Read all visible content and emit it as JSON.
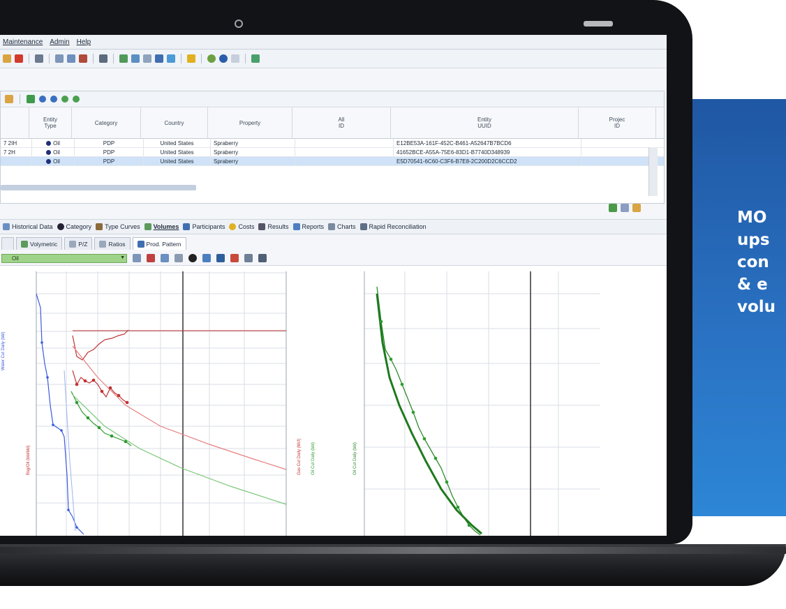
{
  "menu": {
    "items": [
      "Maintenance",
      "Admin",
      "Help"
    ]
  },
  "grid": {
    "headers": [
      "Entity\nType",
      "Category",
      "Country",
      "Property",
      "All\nID",
      "Entity\nUUID",
      "Projec\nID"
    ],
    "rows": [
      {
        "name": "7 2IH",
        "type": "Oil",
        "category": "PDP",
        "country": "United States",
        "property": "Spraberry",
        "uuid": "E12BE53A-161F-452C-B461-A52647B7BCD6"
      },
      {
        "name": "7 2H",
        "type": "Oil",
        "category": "PDP",
        "country": "United States",
        "property": "Spraberry",
        "uuid": "41652BCE-A55A-75E6-83D1-B7740D348939"
      },
      {
        "name": "",
        "type": "Oil",
        "category": "PDP",
        "country": "United States",
        "property": "Spraberry",
        "uuid": "E5D70541-6C60-C3F6-B7E8-2C200D2C6CCD2"
      }
    ]
  },
  "module_tabs": [
    "Historical Data",
    "Category",
    "Type Curves",
    "Volumes",
    "Participants",
    "Costs",
    "Results",
    "Reports",
    "Charts",
    "Rapid Reconciliation"
  ],
  "sub_tabs": [
    "Volymetric",
    "P/Z",
    "Ratios",
    "Prod. Pattern"
  ],
  "chart_toolbar": {
    "product_select": "Oil"
  },
  "charts": {
    "left_axis_labels": [
      "Water Cut Daily (bbl)",
      "Bsg/Oil (bbl/bbl)"
    ],
    "right_axis_labels": [
      "Gas Cut Daily (Mcf)",
      "Oil Cut Daily (bbl)"
    ],
    "right_chart_axis_label": "Oil Cut Daily (bbl)"
  },
  "promo": {
    "text": "MO\nups\ncon\n& e\nvolu"
  },
  "colors": {
    "promo_blue": "#2a71c2",
    "selection_blue": "#cfe2f7",
    "oil_curve": "#2e8b2e",
    "gas_curve": "#d03030",
    "water_curve": "#3b5bdc"
  }
}
